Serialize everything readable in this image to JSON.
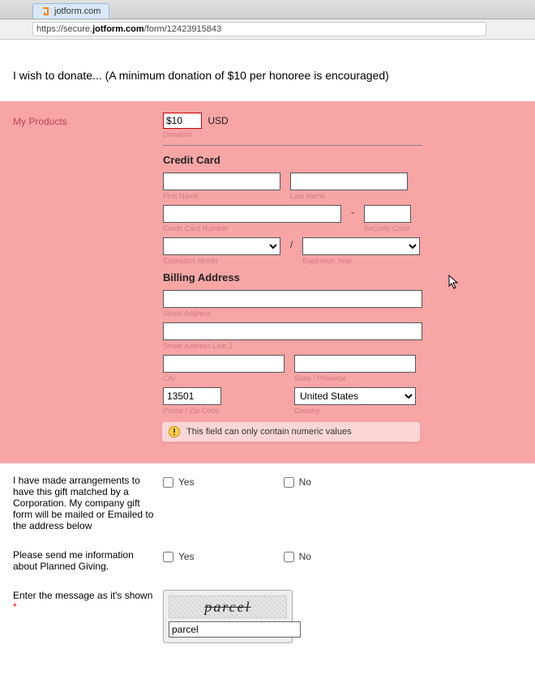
{
  "browser": {
    "tab_title": "jotform.com",
    "url_prefix": "https://secure.",
    "url_bold": "jotform.com",
    "url_suffix": "/form/12423915843"
  },
  "headline": "I wish to donate... (A minimum donation of $10 per honoree is encouraged)",
  "pink": {
    "label": "My Products",
    "donation_value": "$10",
    "currency": "USD",
    "donation_sub": "Donation",
    "cc_heading": "Credit Card",
    "first_name_sub": "First Name",
    "last_name_sub": "Last Name",
    "cc_num_sub": "Credit Card Number",
    "sec_sub": "Security Code",
    "exp_month_sub": "Expiration Month",
    "exp_year_sub": "Expiration Year",
    "billing_heading": "Billing Address",
    "street1_sub": "Street Address",
    "street2_sub": "Street Address Line 2",
    "city_sub": "City",
    "state_sub": "State / Province",
    "zip_value": "13501",
    "zip_sub": "Postal / Zip Code",
    "country_value": "United States",
    "country_sub": "Country",
    "error_msg": "This field can only contain numeric values"
  },
  "q1": {
    "label": "I have made arrangements to have this gift matched by a Corporation. My company gift form will be mailed or Emailed to the address below",
    "yes": "Yes",
    "no": "No"
  },
  "q2": {
    "label": "Please send me information about Planned Giving.",
    "yes": "Yes",
    "no": "No"
  },
  "captcha": {
    "label": "Enter the message as it's shown ",
    "req": "*",
    "img_text": "parcel",
    "input_value": "parcel"
  }
}
